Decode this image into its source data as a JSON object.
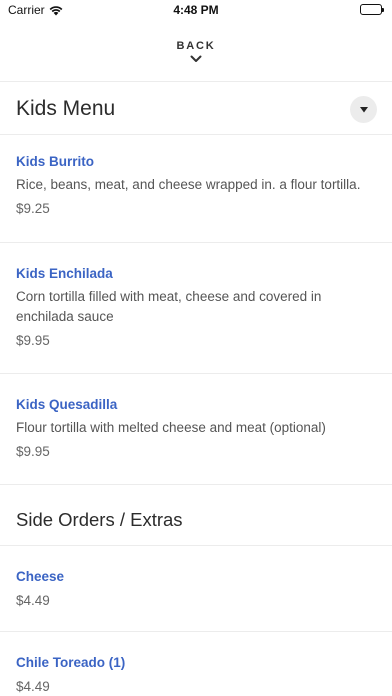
{
  "status_bar": {
    "carrier": "Carrier",
    "time": "4:48 PM"
  },
  "nav": {
    "back_label": "BACK"
  },
  "sections": {
    "kids_menu": {
      "title": "Kids Menu",
      "items": [
        {
          "name": "Kids Burrito",
          "description": "Rice, beans, meat, and cheese wrapped in. a flour tortilla.",
          "price": "$9.25"
        },
        {
          "name": "Kids Enchilada",
          "description": "Corn tortilla filled with meat, cheese and covered in enchilada sauce",
          "price": "$9.95"
        },
        {
          "name": "Kids Quesadilla",
          "description": "Flour tortilla with melted cheese and meat (optional)",
          "price": "$9.95"
        }
      ]
    },
    "side_orders": {
      "title": "Side Orders / Extras",
      "items": [
        {
          "name": "Cheese",
          "price": "$4.49"
        },
        {
          "name": "Chile Toreado (1)",
          "price": "$4.49"
        }
      ]
    }
  },
  "icons": {
    "back": "chevron-down-icon",
    "dropdown": "caret-down-icon",
    "wifi": "wifi-icon",
    "battery": "battery-icon"
  }
}
